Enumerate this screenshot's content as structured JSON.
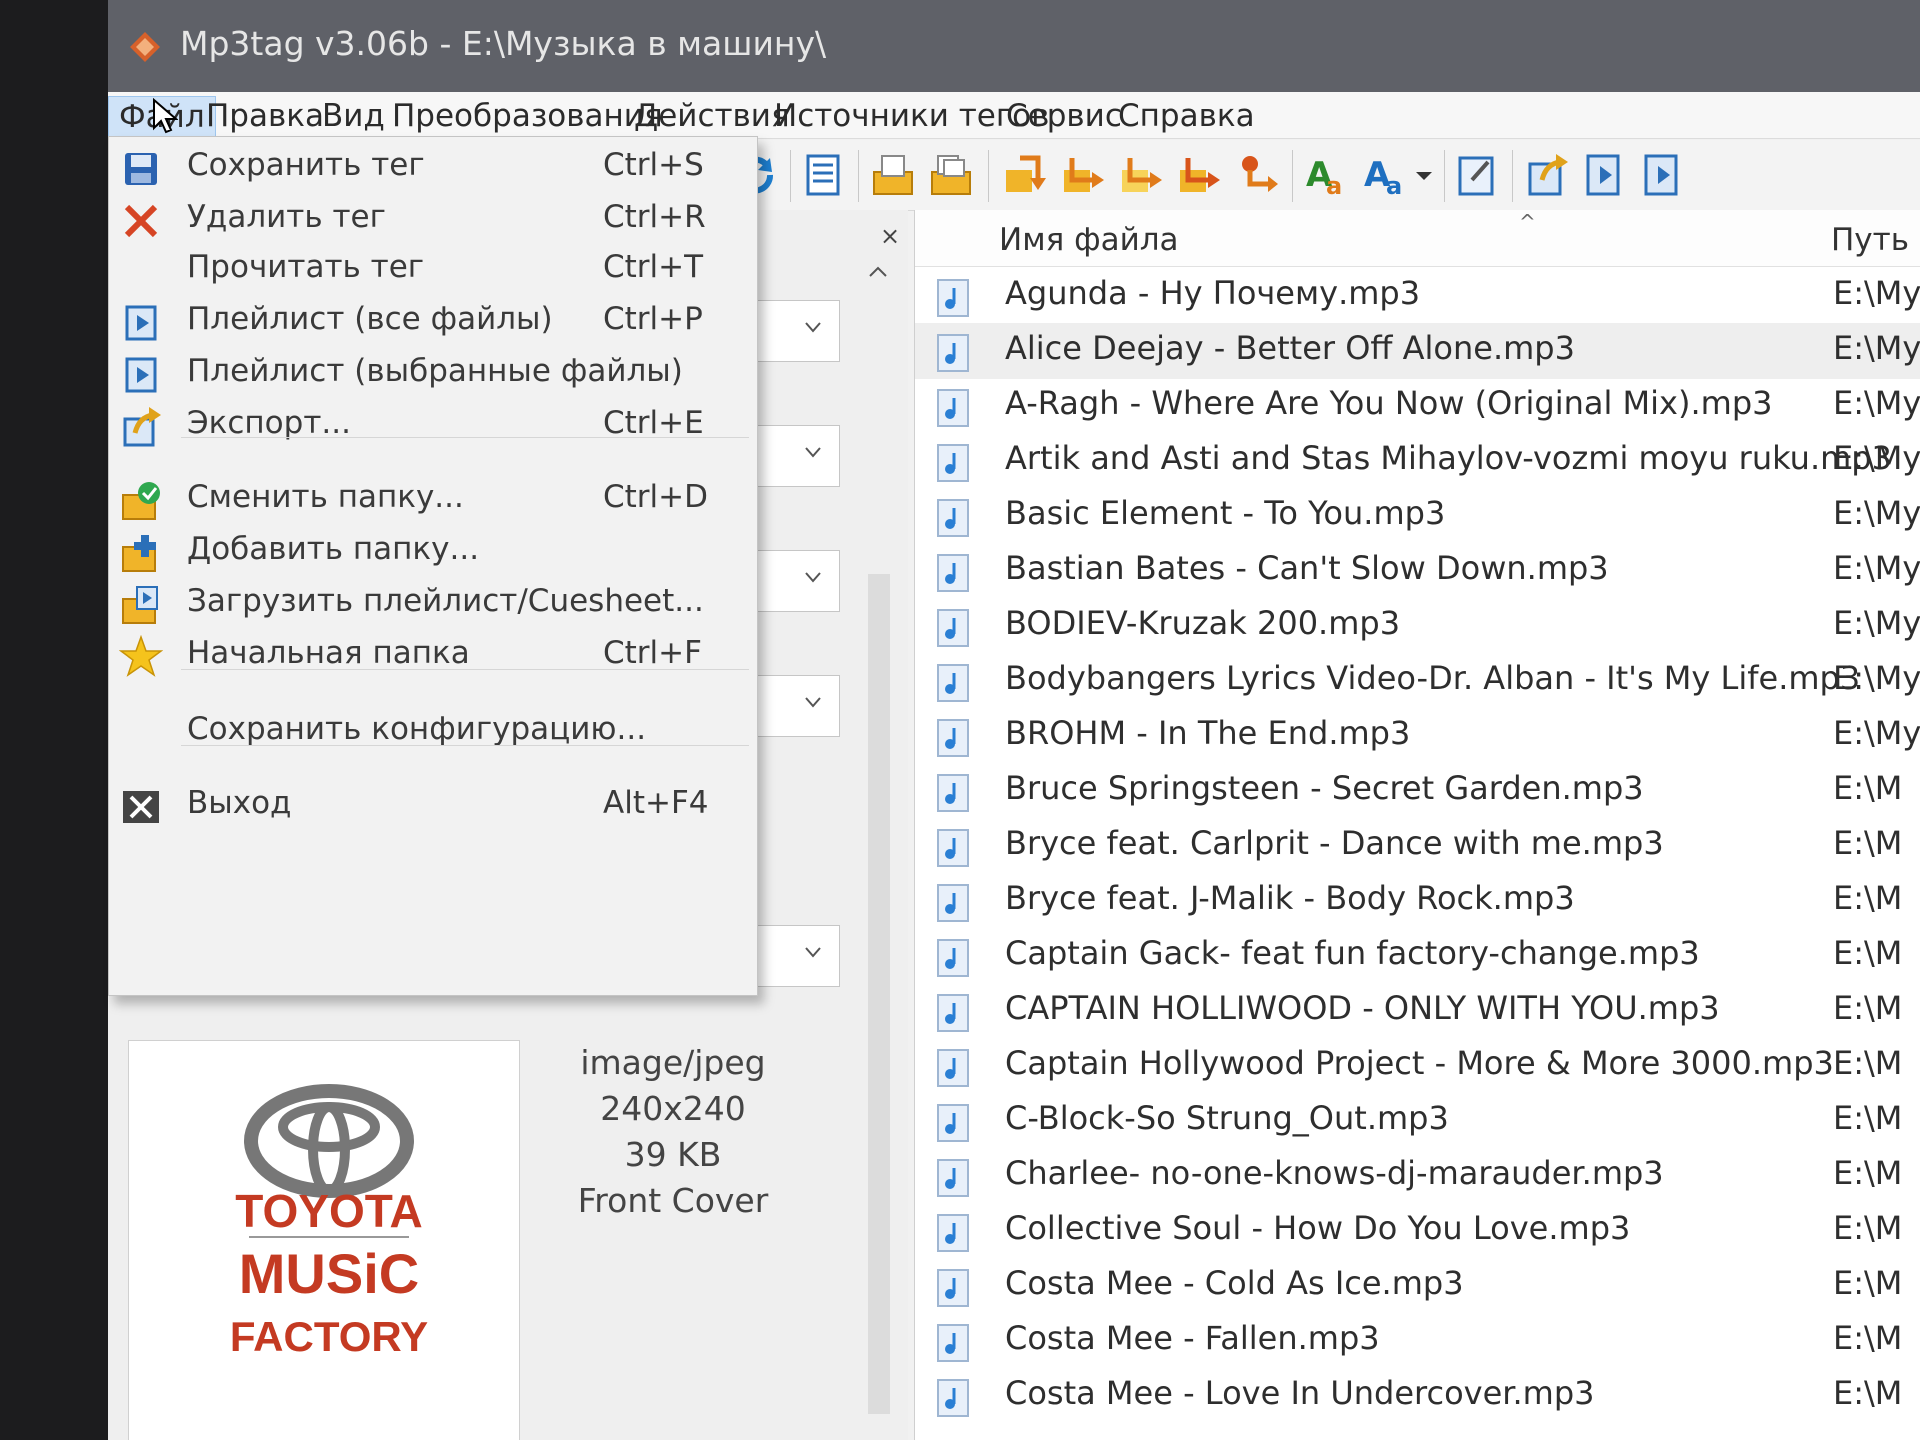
{
  "window": {
    "title": "Mp3tag v3.06b  -  E:\\Музыка в машину\\"
  },
  "menubar": {
    "items": [
      "Файл",
      "Правка",
      "Вид",
      "Преобразования",
      "Действия",
      "Источники тегов",
      "Сервис",
      "Справка"
    ],
    "active": "Файл"
  },
  "toolbar": {
    "icons": [
      "refresh-icon",
      "list-icon",
      "folder-open-icon",
      "folder-copy-icon",
      "tag-convert-icon-1",
      "tag-convert-icon-2",
      "tag-convert-icon-3",
      "tag-convert-icon-4",
      "tag-convert-icon-5",
      "case-convert-icon",
      "text-case-icon",
      "dropdown-arrow-icon",
      "edit-icon",
      "export-icon",
      "playlist-icon",
      "playlist-selected-icon"
    ]
  },
  "file_menu": {
    "items": [
      {
        "label": "Сохранить тег",
        "shortcut": "Ctrl+S",
        "icon": "save-icon"
      },
      {
        "label": "Удалить тег",
        "shortcut": "Ctrl+R",
        "icon": "delete-icon"
      },
      {
        "label": "Прочитать тег",
        "shortcut": "Ctrl+T",
        "icon": ""
      },
      {
        "label": "Плейлист (все файлы)",
        "shortcut": "Ctrl+P",
        "icon": "playlist-icon"
      },
      {
        "label": "Плейлист (выбранные файлы)",
        "shortcut": "",
        "icon": "playlist-icon"
      },
      {
        "label": "Экспорт...",
        "shortcut": "Ctrl+E",
        "icon": "export-icon"
      },
      {
        "label": "Сменить папку...",
        "shortcut": "Ctrl+D",
        "icon": "change-folder-icon"
      },
      {
        "label": "Добавить папку...",
        "shortcut": "",
        "icon": "add-folder-icon"
      },
      {
        "label": "Загрузить плейлист/Cuesheet...",
        "shortcut": "",
        "icon": "load-playlist-icon"
      },
      {
        "label": "Начальная папка",
        "shortcut": "Ctrl+F",
        "icon": "star-icon"
      },
      {
        "label": "Сохранить конфигурацию...",
        "shortcut": "",
        "icon": ""
      },
      {
        "label": "Выход",
        "shortcut": "Alt+F4",
        "icon": "exit-icon"
      }
    ]
  },
  "cover": {
    "logo_text": [
      "TOYOTA",
      "MUSiC",
      "FACTORY"
    ],
    "mime": "image/jpeg",
    "dimensions": "240x240",
    "size": "39 KB",
    "type": "Front Cover"
  },
  "file_list": {
    "columns": {
      "name": "Имя файла",
      "path": "Путь"
    },
    "selected_index": 1,
    "rows": [
      {
        "name": "Agunda - Ну Почему.mp3",
        "path": "E:\\Муз"
      },
      {
        "name": "Alice Deejay - Better Off Alone.mp3",
        "path": "E:\\Му:"
      },
      {
        "name": "A-Ragh - Where Are You Now (Original Mix).mp3",
        "path": "E:\\Му:"
      },
      {
        "name": "Artik and Asti and Stas Mihaylov-vozmi moyu ruku.mp3",
        "path": "E:\\My"
      },
      {
        "name": "Basic Element - To You.mp3",
        "path": "E:\\My"
      },
      {
        "name": "Bastian Bates - Can't Slow Down.mp3",
        "path": "E:\\My"
      },
      {
        "name": "BODIEV-Kruzak 200.mp3",
        "path": "E:\\My"
      },
      {
        "name": "Bodybangers Lyrics Video-Dr. Alban - It's My Life.mp3",
        "path": "E:\\My"
      },
      {
        "name": "BROHM - In The End.mp3",
        "path": "E:\\My"
      },
      {
        "name": "Bruce Springsteen - Secret Garden.mp3",
        "path": "E:\\M"
      },
      {
        "name": "Bryce feat. Carlprit - Dance with me.mp3",
        "path": "E:\\M"
      },
      {
        "name": "Bryce feat. J-Malik - Body Rock.mp3",
        "path": "E:\\M"
      },
      {
        "name": "Captain Gack- feat  fun factory-change.mp3",
        "path": "E:\\M"
      },
      {
        "name": "CAPTAIN HOLLIWOOD - ONLY WITH YOU.mp3",
        "path": "E:\\M"
      },
      {
        "name": "Captain Hollywood Project - More & More 3000.mp3",
        "path": "E:\\M"
      },
      {
        "name": "C-Block-So Strung_Out.mp3",
        "path": "E:\\M"
      },
      {
        "name": "Charlee- no-one-knows-dj-marauder.mp3",
        "path": "E:\\M"
      },
      {
        "name": "Collective Soul - How Do You Love.mp3",
        "path": "E:\\M"
      },
      {
        "name": "Costa Mee - Cold As Ice.mp3",
        "path": "E:\\M"
      },
      {
        "name": "Costa Mee - Fallen.mp3",
        "path": "E:\\M"
      },
      {
        "name": "Costa Mee - Love In Undercover.mp3",
        "path": "E:\\M"
      }
    ]
  }
}
